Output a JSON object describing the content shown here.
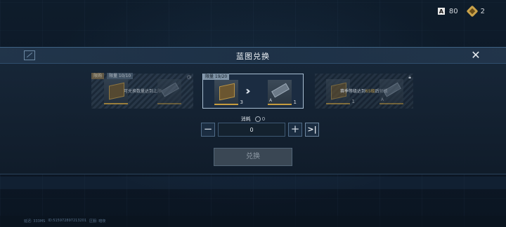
{
  "currency": [
    {
      "icon": "a-token-icon",
      "glyph": "A",
      "value": "80"
    },
    {
      "icon": "gold-crate-icon",
      "value": "2"
    }
  ],
  "dialog": {
    "title": "蓝图兑换",
    "close_glyph": "✕"
  },
  "cards": {
    "left": {
      "tag1": "限购",
      "tag2": "限量 10/10",
      "note": "可兑换数量达到上限",
      "corner_icon": "clock-icon"
    },
    "middle": {
      "tag": "限量 19/20",
      "from_count": "3",
      "to_count": "1",
      "to_level": "A"
    },
    "right": {
      "note_prefix": "赛季等级达到",
      "note_highlight": "65级",
      "note_suffix": "后解锁",
      "tile_level": "A",
      "tile_count": "1",
      "corner_icon": "lock-icon"
    }
  },
  "consume": {
    "label": "消耗",
    "value": "0"
  },
  "quantity": {
    "minus": "−",
    "value": "0",
    "plus": "+",
    "max": ">|"
  },
  "exchange_button": "兑换",
  "footer": {
    "ping": "延迟: 333MS",
    "id": "ID:515972897213201",
    "server": "区服: 暗夜"
  },
  "colors": {
    "accent_gold": "#c79d3f",
    "panel_border": "#3e6283",
    "highlight": "#e3b651"
  }
}
